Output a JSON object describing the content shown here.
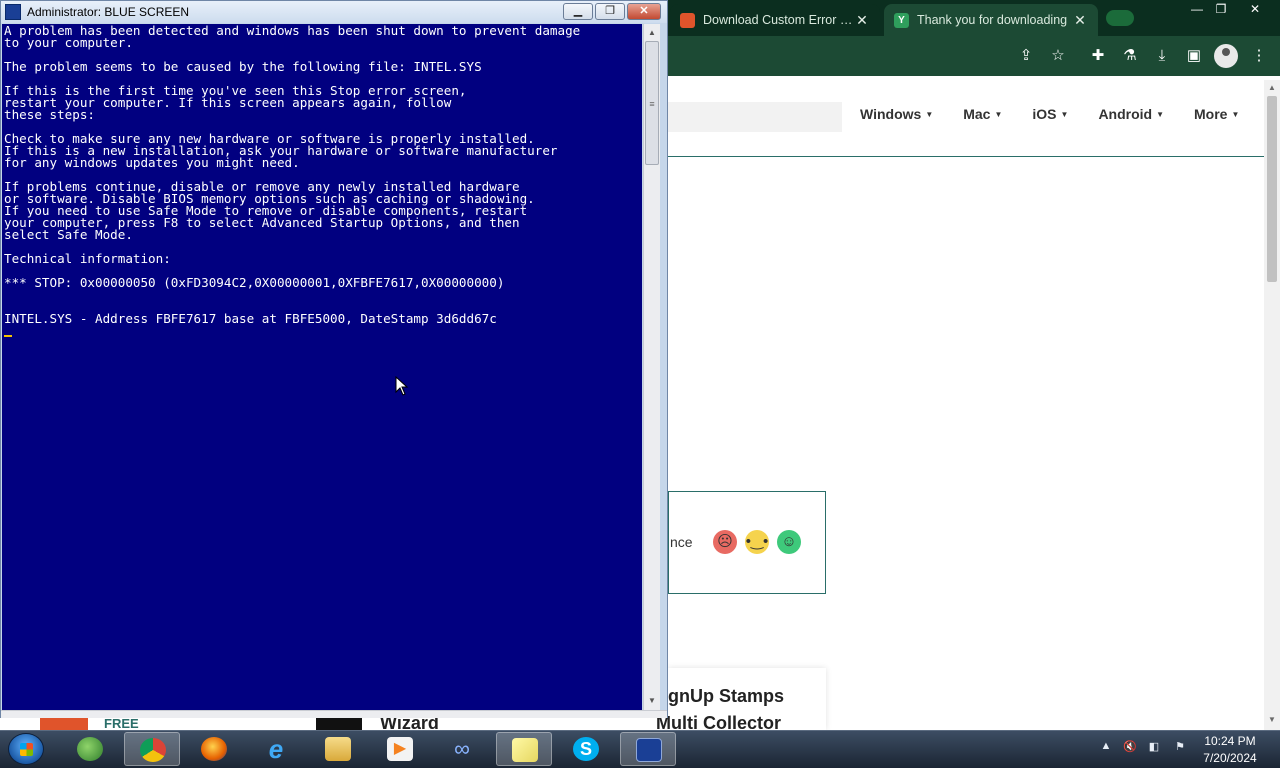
{
  "console": {
    "title": "Administrator:  BLUE SCREEN",
    "minimize": "▁",
    "restore": "❐",
    "close": "✕",
    "bsod_text": "A problem has been detected and windows has been shut down to prevent damage\nto your computer.\n\nThe problem seems to be caused by the following file: INTEL.SYS\n\nIf this is the first time you've seen this Stop error screen,\nrestart your computer. If this screen appears again, follow\nthese steps:\n\nCheck to make sure any new hardware or software is properly installed.\nIf this is a new installation, ask your hardware or software manufacturer\nfor any windows updates you might need.\n\nIf problems continue, disable or remove any newly installed hardware\nor software. Disable BIOS memory options such as caching or shadowing.\nIf you need to use Safe Mode to remove or disable components, restart\nyour computer, press F8 to select Advanced Startup Options, and then\nselect Safe Mode.\n\nTechnical information:\n\n*** STOP: 0x00000050 (0xFD3094C2,0X00000001,0XFBFE7617,0X00000000)\n\n\nINTEL.SYS - Address FBFE7617 base at FBFE5000, DateStamp 3d6dd67c"
  },
  "browser": {
    "tabs": [
      {
        "title": "Download Custom Error Ma",
        "close": "✕"
      },
      {
        "title": "Thank you for downloading",
        "close": "✕"
      }
    ],
    "window_controls": {
      "minimize": "—",
      "restore": "❐",
      "close": "✕"
    },
    "nav": [
      {
        "label": "Windows"
      },
      {
        "label": "Mac"
      },
      {
        "label": "iOS"
      },
      {
        "label": "Android"
      },
      {
        "label": "More"
      }
    ],
    "feedback_text": "nce",
    "product_title": "gnUp Stamps",
    "product_title2": "Multi Collector",
    "strip_free": "FREE",
    "strip_wizard": "Wizard"
  },
  "icons": {
    "share": "⇪",
    "star": "☆",
    "extensions": "✚",
    "lab": "⚗",
    "download": "⤓",
    "sidebar": "▣",
    "menu": "⋮",
    "face_sad": "☹",
    "face_neutral": "😐",
    "face_happy": "☺"
  },
  "taskbar": {
    "time": "10:24 PM",
    "date": "7/20/2024",
    "items": [
      "Windows Live Messenger",
      "Google Chrome",
      "Firefox",
      "Internet Explorer",
      "Windows Explorer",
      "Media Player",
      "Infinity App",
      "Sticky Notes",
      "Skype",
      "Blue Screen Console"
    ]
  },
  "colors": {
    "bsod_background": "#010080",
    "bsod_text": "#ffffff",
    "browser_frame": "#1c4a34",
    "accent": "#2a6e69"
  }
}
